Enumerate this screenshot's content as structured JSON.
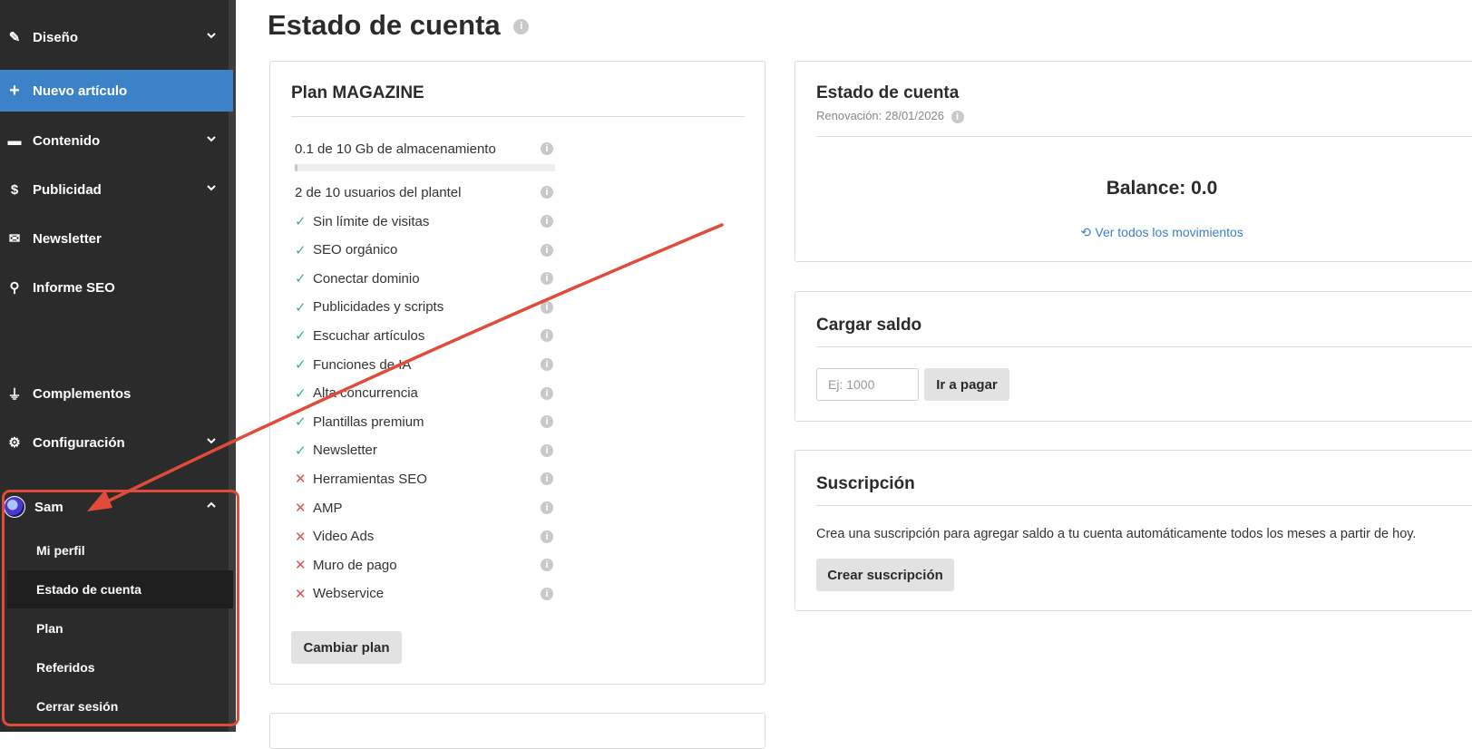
{
  "sidebar": {
    "items": [
      {
        "icon": "brush-icon",
        "glyph": "✎",
        "label": "Diseño"
      },
      {
        "icon": "folder-icon",
        "glyph": "▬",
        "label": "Contenido"
      },
      {
        "icon": "dollar-icon",
        "glyph": "$",
        "label": "Publicidad"
      },
      {
        "icon": "envelope-icon",
        "glyph": "✉",
        "label": "Newsletter"
      },
      {
        "icon": "search-icon",
        "glyph": "⚲",
        "label": "Informe SEO"
      },
      {
        "icon": "plug-icon",
        "glyph": "⏚",
        "label": "Complementos"
      },
      {
        "icon": "gears-icon",
        "glyph": "⚙",
        "label": "Configuración"
      }
    ],
    "new_article": {
      "glyph": "+",
      "label": "Nuevo artículo"
    },
    "user": {
      "name": "Sam",
      "submenu": [
        "Mi perfil",
        "Estado de cuenta",
        "Plan",
        "Referidos",
        "Cerrar sesión"
      ]
    }
  },
  "page": {
    "title": "Estado de cuenta",
    "info_glyph": "i"
  },
  "plan": {
    "title": "Plan MAGAZINE",
    "storage": {
      "label": "0.1 de 10 Gb de almacenamiento",
      "fraction": 0.01
    },
    "users": "2 de 10 usuarios del plantel",
    "features": [
      {
        "label": "Sin límite de visitas",
        "ok": true
      },
      {
        "label": "SEO orgánico",
        "ok": true
      },
      {
        "label": "Conectar dominio",
        "ok": true
      },
      {
        "label": "Publicidades y scripts",
        "ok": true
      },
      {
        "label": "Escuchar artículos",
        "ok": true
      },
      {
        "label": "Funciones de IA",
        "ok": true
      },
      {
        "label": "Alta concurrencia",
        "ok": true
      },
      {
        "label": "Plantillas premium",
        "ok": true
      },
      {
        "label": "Newsletter",
        "ok": true
      },
      {
        "label": "Herramientas SEO",
        "ok": false
      },
      {
        "label": "AMP",
        "ok": false
      },
      {
        "label": "Video Ads",
        "ok": false
      },
      {
        "label": "Muro de pago",
        "ok": false
      },
      {
        "label": "Webservice",
        "ok": false
      }
    ],
    "change_button": "Cambiar plan"
  },
  "account": {
    "title": "Estado de cuenta",
    "renewal": "Renovación: 28/01/2026",
    "balance": "Balance: 0.0",
    "movements_link": "Ver todos los movimientos"
  },
  "topup": {
    "title": "Cargar saldo",
    "placeholder": "Ej: 1000",
    "pay_button": "Ir a pagar"
  },
  "subscription": {
    "title": "Suscripción",
    "description": "Crea una suscripción para agregar saldo a tu cuenta automáticamente todos los meses a partir de hoy.",
    "create_button": "Crear suscripción"
  },
  "colors": {
    "sidebar_bg": "#2b2b2b",
    "accent": "#3b82c8",
    "annotation": "#e04b3a",
    "ok": "#3cb371",
    "no": "#d9534f"
  }
}
